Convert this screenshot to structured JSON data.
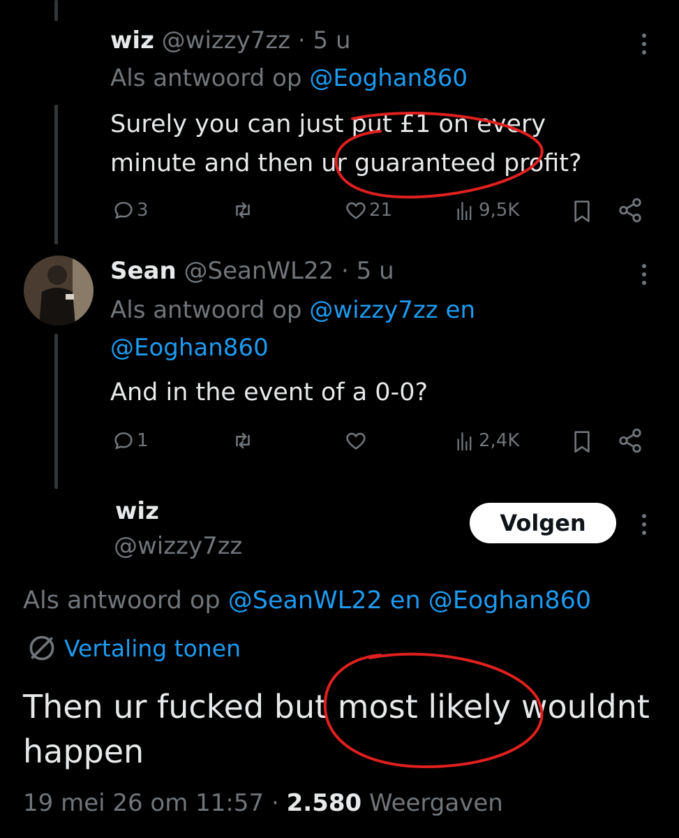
{
  "colors": {
    "background": "#000000",
    "text": "#e7e9ea",
    "muted": "#71767b",
    "link": "#1d9bf0",
    "annotation": "#e0201f"
  },
  "tweet1": {
    "name": "wiz",
    "handle": "@wizzy7zz",
    "time": "· 5 u",
    "reply_prefix": "Als antwoord op",
    "reply_user": "@Eoghan860",
    "text_line1": "Surely you can just put £1 on every",
    "text_line2": "minute and then ur guaranteed profit?",
    "replies": "3",
    "likes": "21",
    "views": "9,5K"
  },
  "tweet2": {
    "name": "Sean",
    "handle": "@SeanWL22",
    "time": "· 5 u",
    "reply_prefix": "Als antwoord op",
    "reply_user1": "@wizzy7zz",
    "reply_conj": "en",
    "reply_user2": "@Eoghan860",
    "text": "And in the event of a 0-0?",
    "replies": "1",
    "views": "2,4K"
  },
  "main_tweet": {
    "name": "wiz",
    "handle": "@wizzy7zz",
    "follow_label": "Volgen",
    "reply_prefix": "Als antwoord op",
    "reply_user1": "@SeanWL22",
    "reply_conj": "en",
    "reply_user2": "@Eoghan860",
    "translate_label": "Vertaling tonen",
    "text_line1": "Then ur fucked but most likely wouldnt",
    "text_line2": "happen",
    "timestamp": "19 mei 26 om 11:57",
    "separator": "·",
    "view_count": "2.580",
    "view_label": "Weergaven"
  },
  "icons": [
    "reply-icon",
    "retweet-icon",
    "like-icon",
    "views-icon",
    "bookmark-icon",
    "share-icon",
    "more-icon",
    "translate-icon"
  ]
}
